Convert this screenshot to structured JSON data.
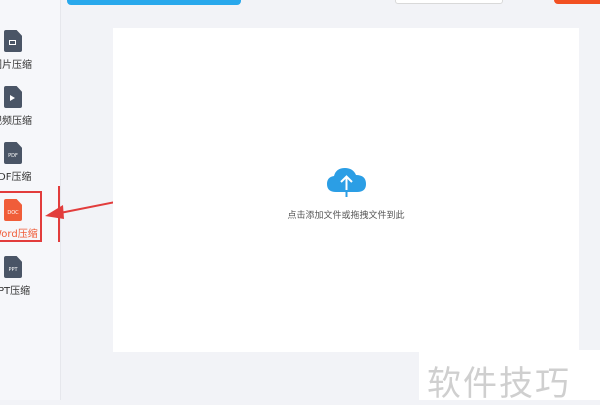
{
  "sidebar": {
    "items": [
      {
        "label": "图片压缩",
        "icon": "image-file-icon",
        "tag": ""
      },
      {
        "label": "视频压缩",
        "icon": "video-file-icon",
        "tag": ""
      },
      {
        "label": "PDF压缩",
        "icon": "pdf-file-icon",
        "tag": "PDF"
      },
      {
        "label": "Word压缩",
        "icon": "doc-file-icon",
        "tag": "DOC",
        "active": true
      },
      {
        "label": "PPT压缩",
        "icon": "ppt-file-icon",
        "tag": "PPT"
      }
    ]
  },
  "dropzone": {
    "hint": "点击添加文件或拖拽文件到此",
    "icon": "cloud-upload-icon"
  },
  "watermark": {
    "text": "软件技巧"
  },
  "colors": {
    "accent": "#29a8ec",
    "active": "#f05d39",
    "annotation": "#e23c3c",
    "icon_dark": "#4a5566"
  }
}
